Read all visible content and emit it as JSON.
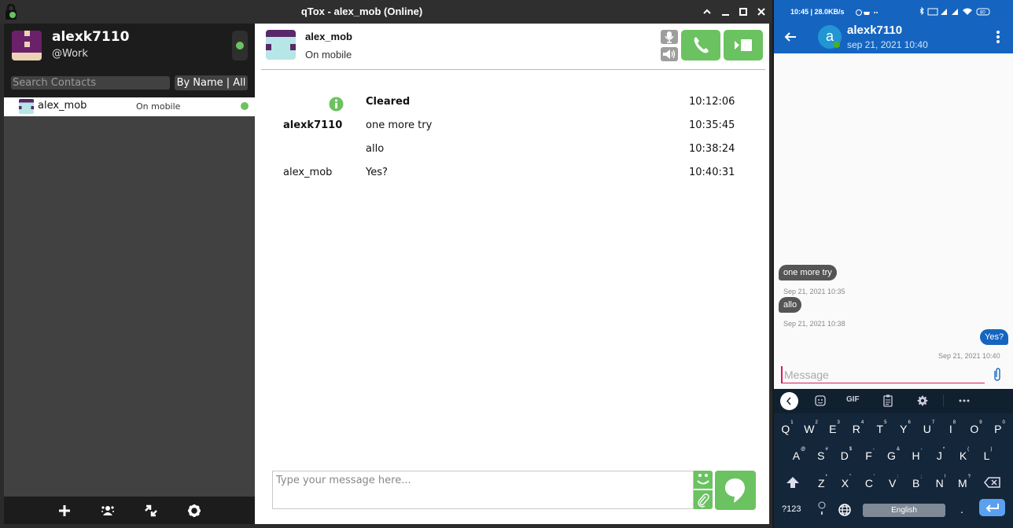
{
  "window": {
    "title": "qTox - alex_mob (Online)",
    "controls": [
      "^",
      "_",
      "☐",
      "✕"
    ]
  },
  "profile": {
    "name": "alexk7110",
    "status_message": "@Work",
    "status": "online",
    "status_color": "#6bc260"
  },
  "search": {
    "placeholder": "Search Contacts"
  },
  "sort_filter": {
    "label": "By Name | All"
  },
  "contacts": [
    {
      "name": "alex_mob",
      "status_text": "On mobile",
      "status": "online"
    }
  ],
  "sidebar_bottom": {
    "buttons": [
      "add-friend",
      "create-group",
      "file-transfers",
      "settings"
    ]
  },
  "chat": {
    "contact_name": "alex_mob",
    "contact_status": "On mobile",
    "messages": [
      {
        "author": "",
        "text": "Cleared",
        "time": "10:12:06",
        "type": "system",
        "icon": "info-icon"
      },
      {
        "author": "alexk7110",
        "text": "one more try",
        "time": "10:35:45",
        "type": "self"
      },
      {
        "author": "",
        "text": "allo",
        "time": "10:38:24",
        "type": "self"
      },
      {
        "author": "alex_mob",
        "text": "Yes?",
        "time": "10:40:31",
        "type": "friend"
      }
    ],
    "input_placeholder": "Type your message here...",
    "accent_color": "#6bc260"
  },
  "phone": {
    "statusbar": {
      "left": "10:45 | 28.0KB/s",
      "battery": "80"
    },
    "contact_name": "alexk7110",
    "contact_initial": "a",
    "last_seen": "sep 21, 2021 10:40",
    "messages": [
      {
        "text": "one more try",
        "time": "Sep 21, 2021 10:35",
        "direction": "in"
      },
      {
        "text": "allo",
        "time": "Sep 21, 2021 10:38",
        "direction": "in"
      },
      {
        "text": "Yes?",
        "time": "Sep 21, 2021 10:40",
        "direction": "out"
      }
    ],
    "input_placeholder": "Message",
    "header_color": "#1565c0",
    "keyboard": {
      "toolbar": [
        "back",
        "sticker",
        "GIF",
        "clipboard",
        "settings",
        "more"
      ],
      "gif_label": "GIF",
      "row1": [
        [
          "Q",
          "1"
        ],
        [
          "W",
          "2"
        ],
        [
          "E",
          "3"
        ],
        [
          "R",
          "4"
        ],
        [
          "T",
          "5"
        ],
        [
          "Y",
          "6"
        ],
        [
          "U",
          "7"
        ],
        [
          "I",
          "8"
        ],
        [
          "O",
          "9"
        ],
        [
          "P",
          "0"
        ]
      ],
      "row2": [
        [
          "A",
          "@"
        ],
        [
          "S",
          "#"
        ],
        [
          "D",
          "$"
        ],
        [
          "F",
          "-"
        ],
        [
          "G",
          "&"
        ],
        [
          "H",
          "-"
        ],
        [
          "J",
          "*"
        ],
        [
          "K",
          "("
        ],
        [
          "L",
          ")"
        ]
      ],
      "row3": [
        [
          "Z",
          "*"
        ],
        [
          "X",
          "\""
        ],
        [
          "C",
          "'"
        ],
        [
          "V",
          ":"
        ],
        [
          "B",
          ";"
        ],
        [
          "N",
          "!"
        ],
        [
          "M",
          "?"
        ]
      ],
      "symbols_label": "?123",
      "space_label": "English",
      "period": "."
    }
  }
}
